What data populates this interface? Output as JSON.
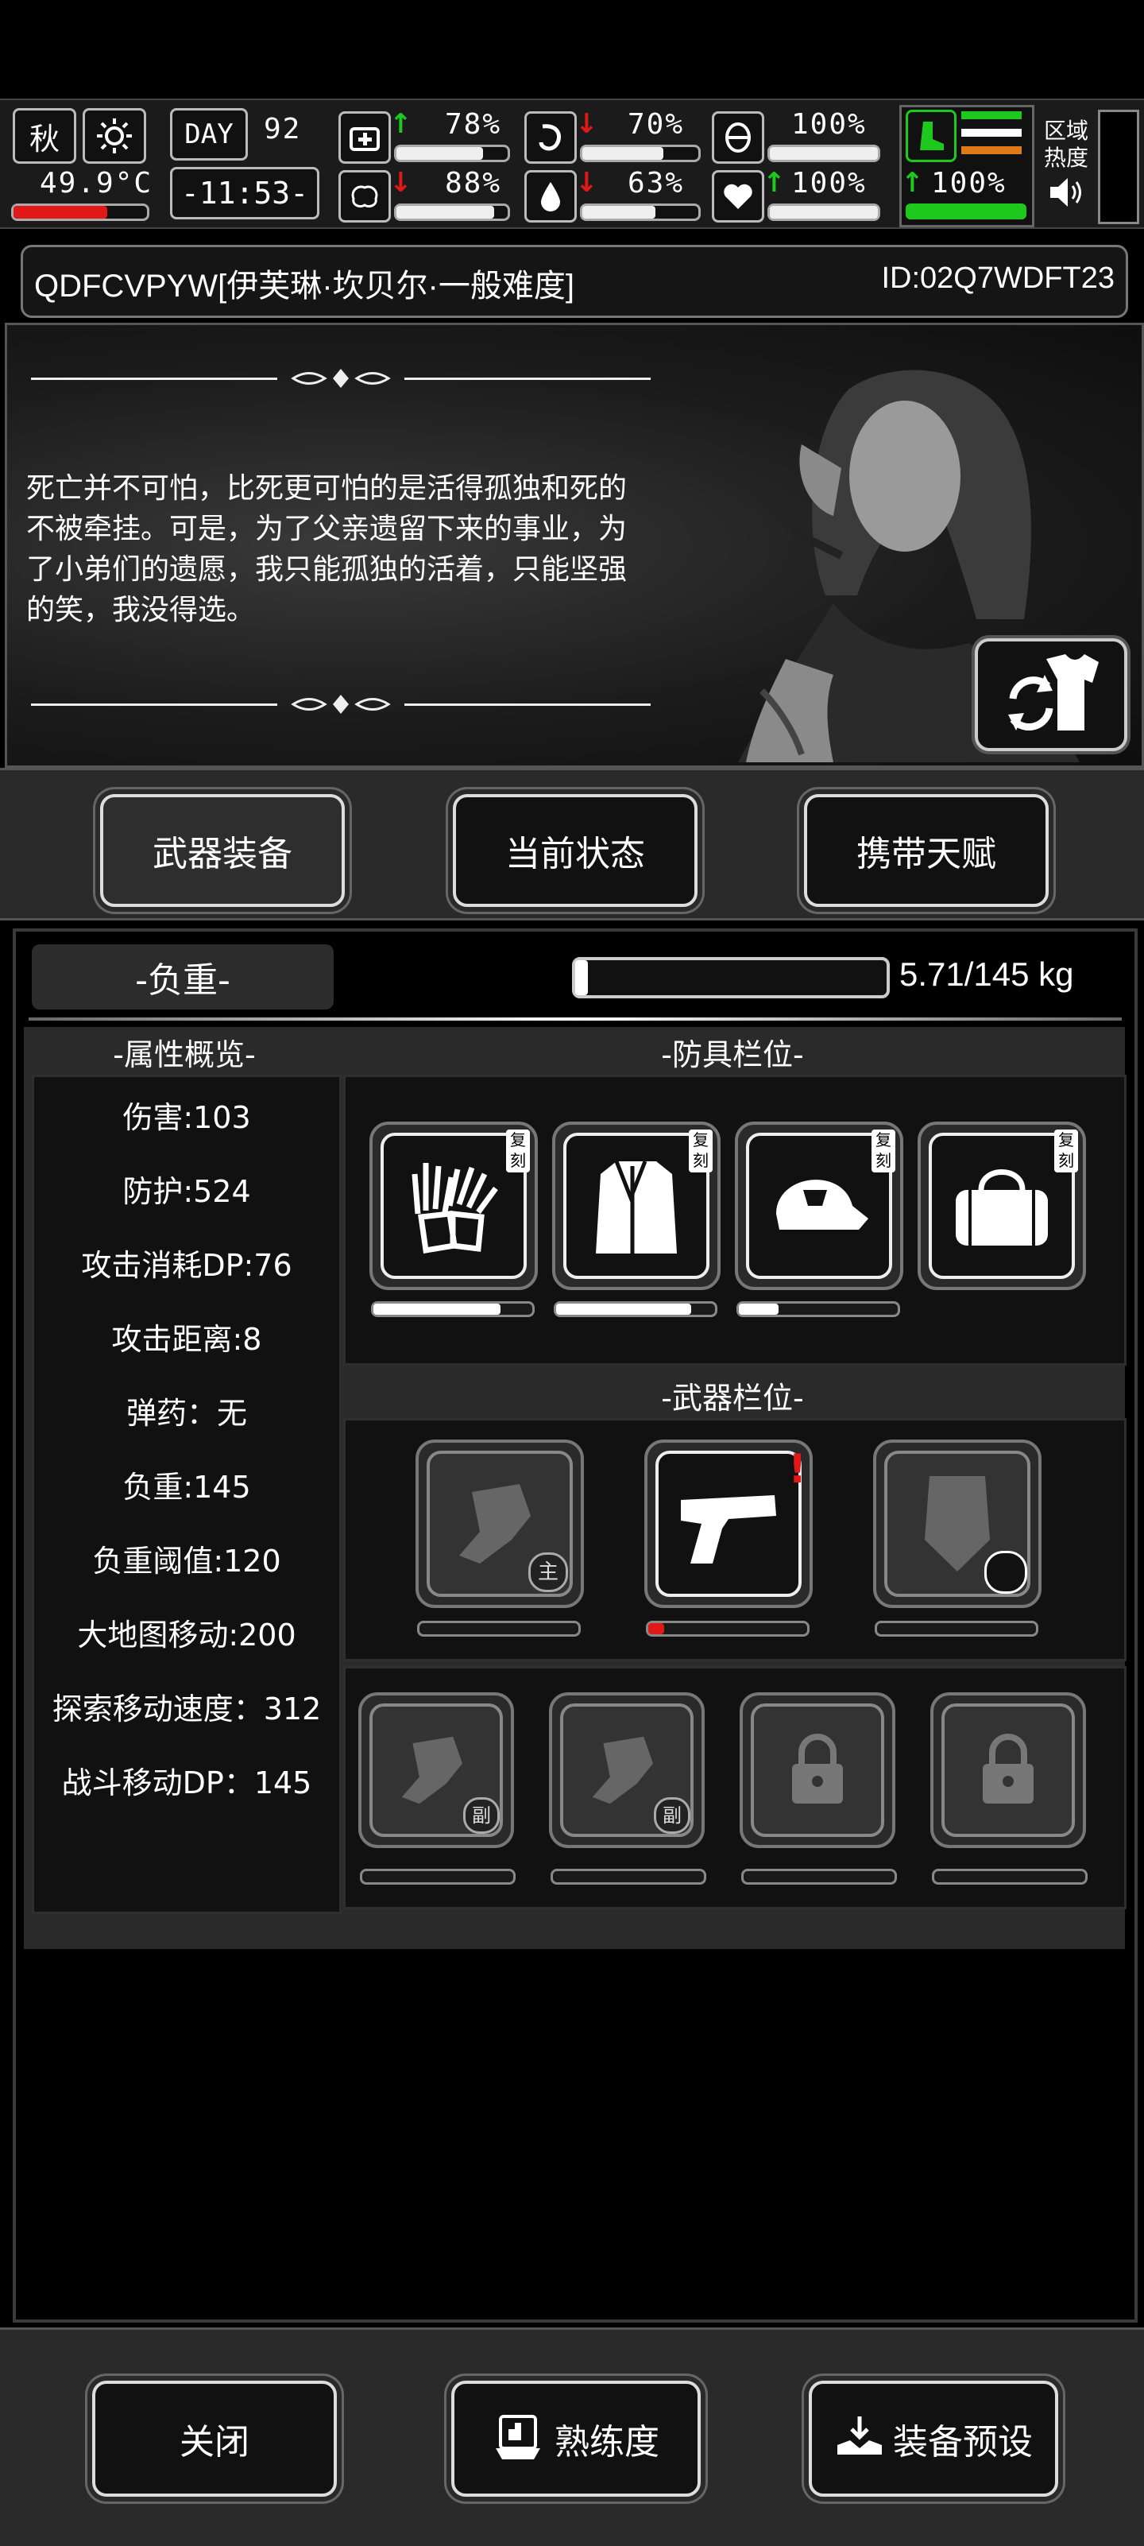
{
  "hud": {
    "season": "秋",
    "temperature": "49.9°C",
    "day_label": "DAY",
    "day_number": "92",
    "clock": "-11:53-",
    "stats": [
      {
        "name": "health",
        "value": "78%",
        "trend": "up",
        "level": 0.78
      },
      {
        "name": "stomach",
        "value": "70%",
        "trend": "down",
        "level": 0.7
      },
      {
        "name": "stamina",
        "value": "100%",
        "trend": "none",
        "level": 1.0
      },
      {
        "name": "brain",
        "value": "88%",
        "trend": "down",
        "level": 0.88
      },
      {
        "name": "water",
        "value": "63%",
        "trend": "down",
        "level": 0.63
      },
      {
        "name": "heart",
        "value": "100%",
        "trend": "up",
        "level": 1.0
      },
      {
        "name": "foot",
        "value": "100%",
        "trend": "up",
        "level": 1.0
      }
    ],
    "zone_heat_label_1": "区域",
    "zone_heat_label_2": "热度"
  },
  "profile": {
    "name": "QDFCVPYW[伊芙琳·坎贝尔·一般难度]",
    "id": "ID:02Q7WDFT23"
  },
  "story": {
    "quote": "死亡并不可怕，比死更可怕的是活得孤独和死的不被牵挂。可是，为了父亲遗留下来的事业，为了小弟们的遗愿，我只能孤独的活着，只能坚强的笑，我没得选。"
  },
  "tabs": [
    {
      "label": "武器装备",
      "active": true
    },
    {
      "label": "当前状态",
      "active": false
    },
    {
      "label": "携带天赋",
      "active": false
    }
  ],
  "weight": {
    "label": "-负重-",
    "value": "5.71/145 kg",
    "fraction": 0.039
  },
  "attributes": {
    "title": "-属性概览-",
    "items": [
      "伤害:103",
      "防护:524",
      "攻击消耗DP:76",
      "攻击距离:8",
      "弹药：无",
      "负重:145",
      "负重阈值:120",
      "大地图移动:200",
      "探索移动速度：312",
      "战斗移动DP：145"
    ]
  },
  "armor": {
    "title": "-防具栏位-",
    "slots": [
      {
        "icon": "gloves-icon",
        "tag": "复刻",
        "durability": 0.8
      },
      {
        "icon": "coat-icon",
        "tag": "复刻",
        "durability": 0.85
      },
      {
        "icon": "cap-icon",
        "tag": "复刻",
        "durability": 0.25
      },
      {
        "icon": "duffel-bag-icon",
        "tag": "复刻",
        "durability": null
      }
    ]
  },
  "weapons": {
    "title": "-武器栏位-",
    "slots": [
      {
        "icon": "fist-icon",
        "badge": "主",
        "durability": 0
      },
      {
        "icon": "pistol-icon",
        "badge": "!",
        "durability": 0.1
      },
      {
        "icon": "riot-shield-icon",
        "badge": "",
        "durability": 0
      }
    ],
    "secondary": [
      {
        "icon": "fist-icon",
        "badge": "副"
      },
      {
        "icon": "fist-icon",
        "badge": "副"
      },
      {
        "icon": "lock-icon",
        "badge": ""
      },
      {
        "icon": "lock-icon",
        "badge": ""
      }
    ]
  },
  "footer": {
    "close": "关闭",
    "proficiency": "熟练度",
    "preset": "装备预设"
  }
}
